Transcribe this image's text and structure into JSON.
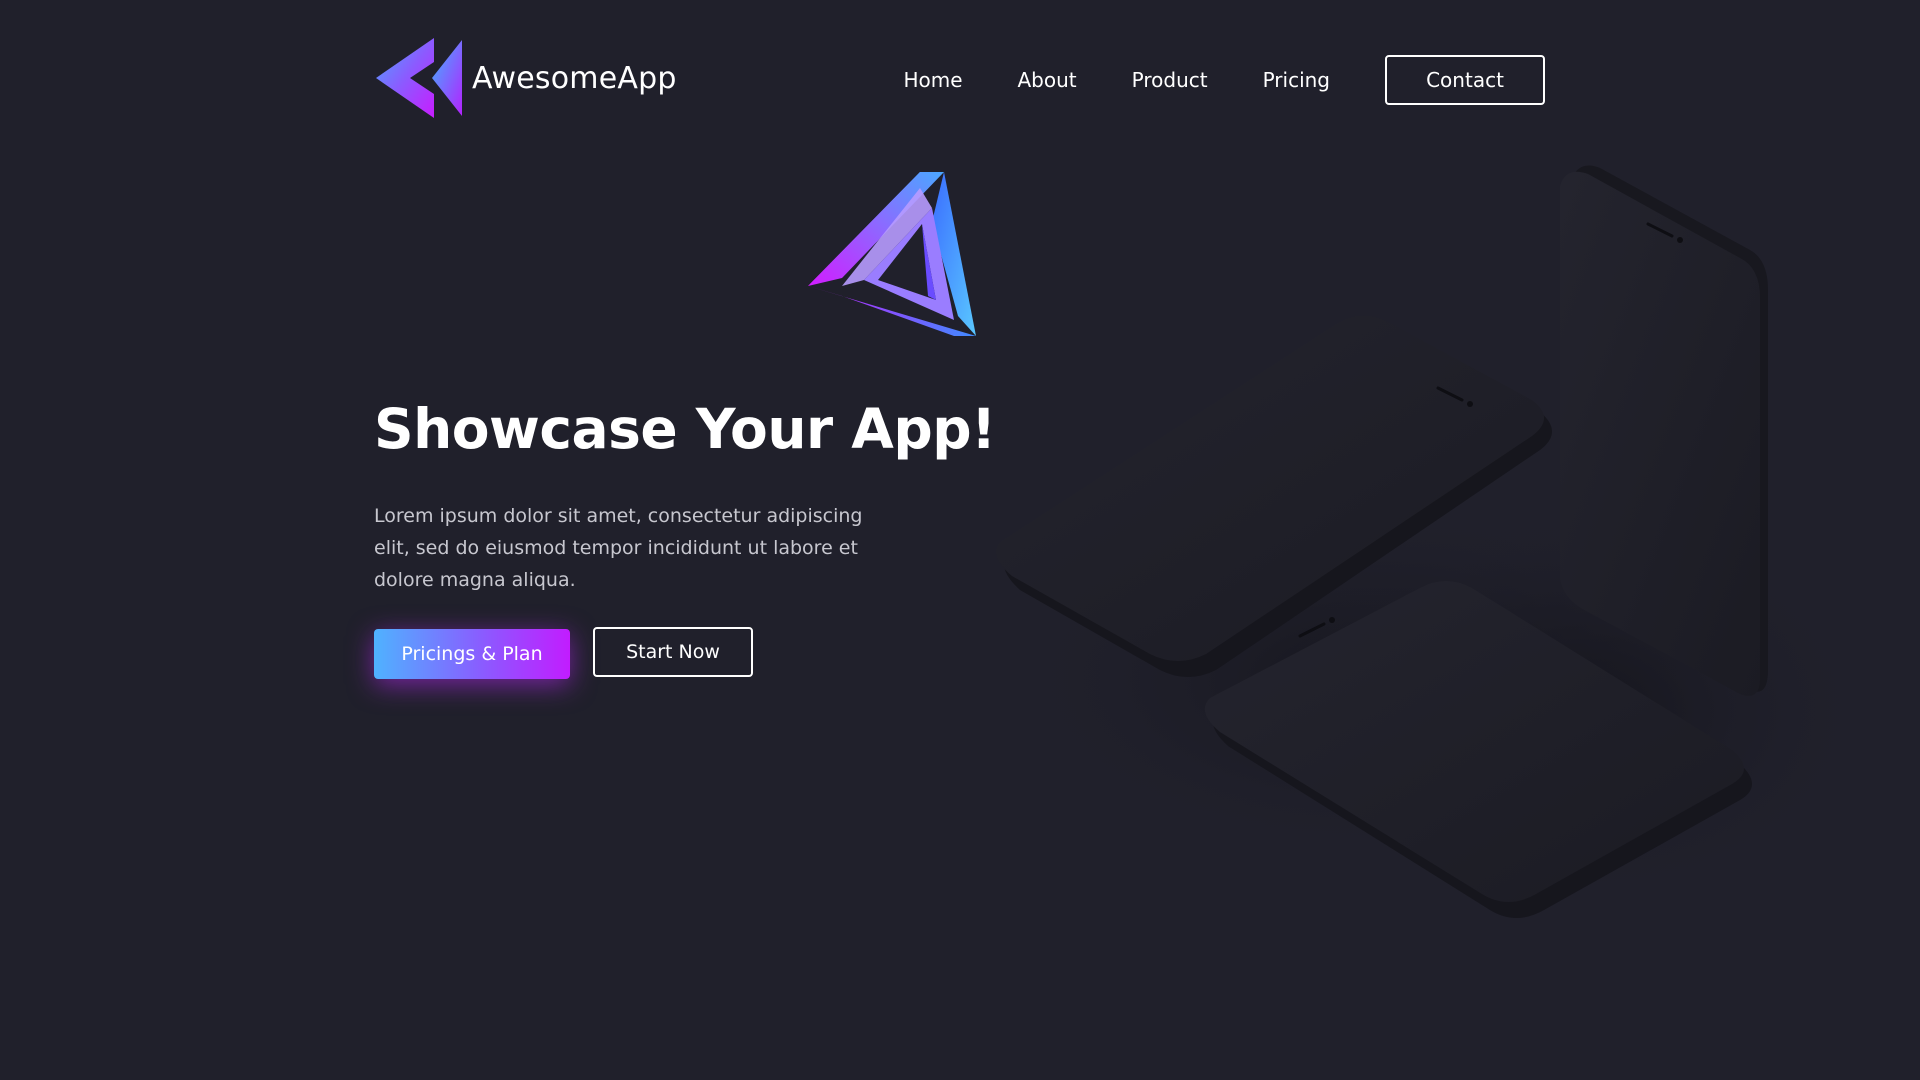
{
  "header": {
    "brand_name": "AwesomeApp",
    "logo_icon": "double-triangle-logo-icon",
    "nav": [
      {
        "label": "Home"
      },
      {
        "label": "About"
      },
      {
        "label": "Product"
      },
      {
        "label": "Pricing"
      }
    ],
    "contact_label": "Contact"
  },
  "hero": {
    "graphic_icon": "gradient-triangle-icon",
    "title": "Showcase Your App!",
    "description": "Lorem ipsum dolor sit amet, consectetur adipiscing elit, sed do eiusmod tempor incididunt ut labore et dolore magna aliqua.",
    "primary_button": "Pricings & Plan",
    "secondary_button": "Start Now"
  },
  "illustration": {
    "icon": "smartphones-mockup"
  },
  "colors": {
    "background": "#20202b",
    "gradient_start": "#4fb2ff",
    "gradient_mid": "#8a5cff",
    "gradient_end": "#c21cff",
    "text": "#ffffff",
    "muted_text": "#c7c7cf",
    "phone_body": "#1c1c24"
  }
}
